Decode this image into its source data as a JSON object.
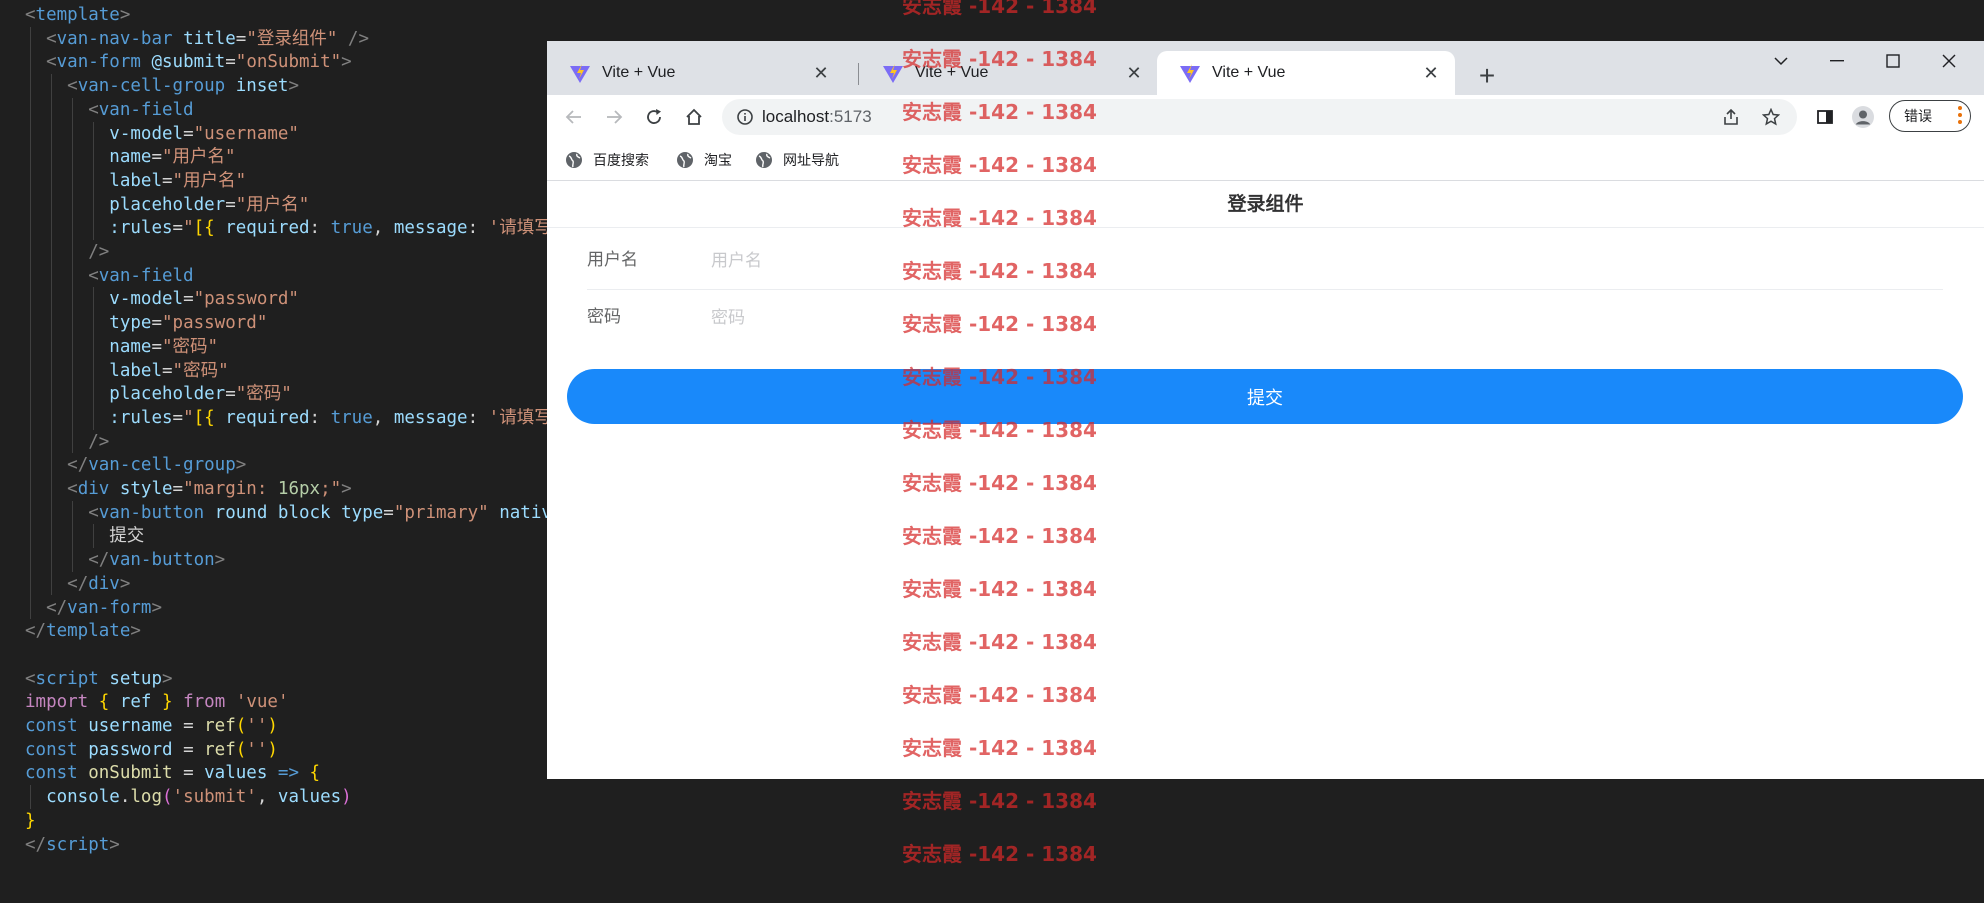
{
  "editor": {
    "lines": [
      [
        [
          "<",
          "t-punc"
        ],
        [
          "template",
          "t-tag"
        ],
        [
          ">",
          "t-punc"
        ]
      ],
      [
        [
          "  ",
          ""
        ],
        [
          "<",
          "t-punc"
        ],
        [
          "van-nav-bar",
          "t-tag"
        ],
        [
          " ",
          ""
        ],
        [
          "title",
          "t-attr"
        ],
        [
          "=",
          "t-txt"
        ],
        [
          "\"登录组件\"",
          "t-str"
        ],
        [
          " />",
          "t-punc"
        ]
      ],
      [
        [
          "  ",
          ""
        ],
        [
          "<",
          "t-punc"
        ],
        [
          "van-form",
          "t-tag"
        ],
        [
          " ",
          ""
        ],
        [
          "@submit",
          "t-attr"
        ],
        [
          "=",
          "t-txt"
        ],
        [
          "\"onSubmit\"",
          "t-str"
        ],
        [
          ">",
          "t-punc"
        ]
      ],
      [
        [
          "    ",
          ""
        ],
        [
          "<",
          "t-punc"
        ],
        [
          "van-cell-group",
          "t-tag"
        ],
        [
          " ",
          ""
        ],
        [
          "inset",
          "t-attr"
        ],
        [
          ">",
          "t-punc"
        ]
      ],
      [
        [
          "      ",
          ""
        ],
        [
          "<",
          "t-punc"
        ],
        [
          "van-field",
          "t-tag"
        ]
      ],
      [
        [
          "        ",
          ""
        ],
        [
          "v-model",
          "t-attr"
        ],
        [
          "=",
          "t-txt"
        ],
        [
          "\"username\"",
          "t-str"
        ]
      ],
      [
        [
          "        ",
          ""
        ],
        [
          "name",
          "t-attr"
        ],
        [
          "=",
          "t-txt"
        ],
        [
          "\"用户名\"",
          "t-str"
        ]
      ],
      [
        [
          "        ",
          ""
        ],
        [
          "label",
          "t-attr"
        ],
        [
          "=",
          "t-txt"
        ],
        [
          "\"用户名\"",
          "t-str"
        ]
      ],
      [
        [
          "        ",
          ""
        ],
        [
          "placeholder",
          "t-attr"
        ],
        [
          "=",
          "t-txt"
        ],
        [
          "\"用户名\"",
          "t-str"
        ]
      ],
      [
        [
          "        ",
          ""
        ],
        [
          ":rules",
          "t-attr"
        ],
        [
          "=",
          "t-txt"
        ],
        [
          "\"",
          "t-str"
        ],
        [
          "[{",
          "t-br1"
        ],
        [
          " required",
          "t-var"
        ],
        [
          ": ",
          "t-txt"
        ],
        [
          "true",
          "t-kw"
        ],
        [
          ", ",
          "t-txt"
        ],
        [
          "message",
          "t-var"
        ],
        [
          ": ",
          "t-txt"
        ],
        [
          "'请填写用户",
          "t-str"
        ]
      ],
      [
        [
          "      ",
          ""
        ],
        [
          "/>",
          "t-punc"
        ]
      ],
      [
        [
          "      ",
          ""
        ],
        [
          "<",
          "t-punc"
        ],
        [
          "van-field",
          "t-tag"
        ]
      ],
      [
        [
          "        ",
          ""
        ],
        [
          "v-model",
          "t-attr"
        ],
        [
          "=",
          "t-txt"
        ],
        [
          "\"password\"",
          "t-str"
        ]
      ],
      [
        [
          "        ",
          ""
        ],
        [
          "type",
          "t-attr"
        ],
        [
          "=",
          "t-txt"
        ],
        [
          "\"password\"",
          "t-str"
        ]
      ],
      [
        [
          "        ",
          ""
        ],
        [
          "name",
          "t-attr"
        ],
        [
          "=",
          "t-txt"
        ],
        [
          "\"密码\"",
          "t-str"
        ]
      ],
      [
        [
          "        ",
          ""
        ],
        [
          "label",
          "t-attr"
        ],
        [
          "=",
          "t-txt"
        ],
        [
          "\"密码\"",
          "t-str"
        ]
      ],
      [
        [
          "        ",
          ""
        ],
        [
          "placeholder",
          "t-attr"
        ],
        [
          "=",
          "t-txt"
        ],
        [
          "\"密码\"",
          "t-str"
        ]
      ],
      [
        [
          "        ",
          ""
        ],
        [
          ":rules",
          "t-attr"
        ],
        [
          "=",
          "t-txt"
        ],
        [
          "\"",
          "t-str"
        ],
        [
          "[{",
          "t-br1"
        ],
        [
          " required",
          "t-var"
        ],
        [
          ": ",
          "t-txt"
        ],
        [
          "true",
          "t-kw"
        ],
        [
          ", ",
          "t-txt"
        ],
        [
          "message",
          "t-var"
        ],
        [
          ": ",
          "t-txt"
        ],
        [
          "'请填写密码",
          "t-str"
        ]
      ],
      [
        [
          "      ",
          ""
        ],
        [
          "/>",
          "t-punc"
        ]
      ],
      [
        [
          "    ",
          ""
        ],
        [
          "</",
          "t-punc"
        ],
        [
          "van-cell-group",
          "t-tag"
        ],
        [
          ">",
          "t-punc"
        ]
      ],
      [
        [
          "    ",
          ""
        ],
        [
          "<",
          "t-punc"
        ],
        [
          "div",
          "t-tag"
        ],
        [
          " ",
          ""
        ],
        [
          "style",
          "t-attr"
        ],
        [
          "=",
          "t-txt"
        ],
        [
          "\"margin: ",
          "t-str"
        ],
        [
          "16px",
          "t-num"
        ],
        [
          ";\"",
          "t-str"
        ],
        [
          ">",
          "t-punc"
        ]
      ],
      [
        [
          "      ",
          ""
        ],
        [
          "<",
          "t-punc"
        ],
        [
          "van-button",
          "t-tag"
        ],
        [
          " ",
          ""
        ],
        [
          "round",
          "t-attr"
        ],
        [
          " ",
          ""
        ],
        [
          "block",
          "t-attr"
        ],
        [
          " ",
          ""
        ],
        [
          "type",
          "t-attr"
        ],
        [
          "=",
          "t-txt"
        ],
        [
          "\"primary\"",
          "t-str"
        ],
        [
          " ",
          ""
        ],
        [
          "native-ty",
          "t-attr"
        ]
      ],
      [
        [
          "        ",
          ""
        ],
        [
          "提交",
          "t-txt"
        ]
      ],
      [
        [
          "      ",
          ""
        ],
        [
          "</",
          "t-punc"
        ],
        [
          "van-button",
          "t-tag"
        ],
        [
          ">",
          "t-punc"
        ]
      ],
      [
        [
          "    ",
          ""
        ],
        [
          "</",
          "t-punc"
        ],
        [
          "div",
          "t-tag"
        ],
        [
          ">",
          "t-punc"
        ]
      ],
      [
        [
          "  ",
          ""
        ],
        [
          "</",
          "t-punc"
        ],
        [
          "van-form",
          "t-tag"
        ],
        [
          ">",
          "t-punc"
        ]
      ],
      [
        [
          "</",
          "t-punc"
        ],
        [
          "template",
          "t-tag"
        ],
        [
          ">",
          "t-punc"
        ]
      ],
      [],
      [
        [
          "<",
          "t-punc"
        ],
        [
          "script",
          "t-tag"
        ],
        [
          " ",
          ""
        ],
        [
          "setup",
          "t-attr"
        ],
        [
          ">",
          "t-punc"
        ]
      ],
      [
        [
          "import",
          "t-ctl"
        ],
        [
          " ",
          ""
        ],
        [
          "{",
          "t-br1"
        ],
        [
          " ",
          ""
        ],
        [
          "ref",
          "t-var"
        ],
        [
          " ",
          ""
        ],
        [
          "}",
          "t-br1"
        ],
        [
          " ",
          ""
        ],
        [
          "from",
          "t-ctl"
        ],
        [
          " ",
          ""
        ],
        [
          "'vue'",
          "t-str"
        ]
      ],
      [
        [
          "const",
          "t-kw"
        ],
        [
          " ",
          ""
        ],
        [
          "username",
          "t-var"
        ],
        [
          " = ",
          "t-txt"
        ],
        [
          "ref",
          "t-fn"
        ],
        [
          "(",
          "t-br1"
        ],
        [
          "''",
          "t-str"
        ],
        [
          ")",
          "t-br1"
        ]
      ],
      [
        [
          "const",
          "t-kw"
        ],
        [
          " ",
          ""
        ],
        [
          "password",
          "t-var"
        ],
        [
          " = ",
          "t-txt"
        ],
        [
          "ref",
          "t-fn"
        ],
        [
          "(",
          "t-br1"
        ],
        [
          "''",
          "t-str"
        ],
        [
          ")",
          "t-br1"
        ]
      ],
      [
        [
          "const",
          "t-kw"
        ],
        [
          " ",
          ""
        ],
        [
          "onSubmit",
          "t-fn"
        ],
        [
          " = ",
          "t-txt"
        ],
        [
          "values",
          "t-var"
        ],
        [
          " ",
          ""
        ],
        [
          "=>",
          "t-kw"
        ],
        [
          " ",
          ""
        ],
        [
          "{",
          "t-br1"
        ]
      ],
      [
        [
          "  ",
          ""
        ],
        [
          "console",
          "t-var"
        ],
        [
          ".",
          "t-txt"
        ],
        [
          "log",
          "t-fn"
        ],
        [
          "(",
          "t-br2"
        ],
        [
          "'submit'",
          "t-str"
        ],
        [
          ", ",
          "t-txt"
        ],
        [
          "values",
          "t-var"
        ],
        [
          ")",
          "t-br2"
        ]
      ],
      [
        [
          "}",
          "t-br1"
        ]
      ],
      [
        [
          "</",
          "t-punc"
        ],
        [
          "script",
          "t-tag"
        ],
        [
          ">",
          "t-punc"
        ]
      ]
    ]
  },
  "browser": {
    "tabs": [
      {
        "title": "Vite + Vue",
        "close": "✕",
        "active": false
      },
      {
        "title": "Vite + Vue",
        "close": "✕",
        "active": false
      },
      {
        "title": "Vite + Vue",
        "close": "✕",
        "active": true
      }
    ],
    "new_tab": "+",
    "url_host": "localhost",
    "url_port": ":5173",
    "error_label": "错误",
    "bookmarks": [
      "百度搜索",
      "淘宝",
      "网址导航"
    ],
    "accent": "#1989fa"
  },
  "page": {
    "nav_title": "登录组件",
    "fields": [
      {
        "label": "用户名",
        "placeholder": "用户名",
        "value": ""
      },
      {
        "label": "密码",
        "placeholder": "密码",
        "value": ""
      }
    ],
    "submit_label": "提交"
  },
  "watermark": {
    "text": "安志霞 -142 - 1384",
    "count": 17
  }
}
